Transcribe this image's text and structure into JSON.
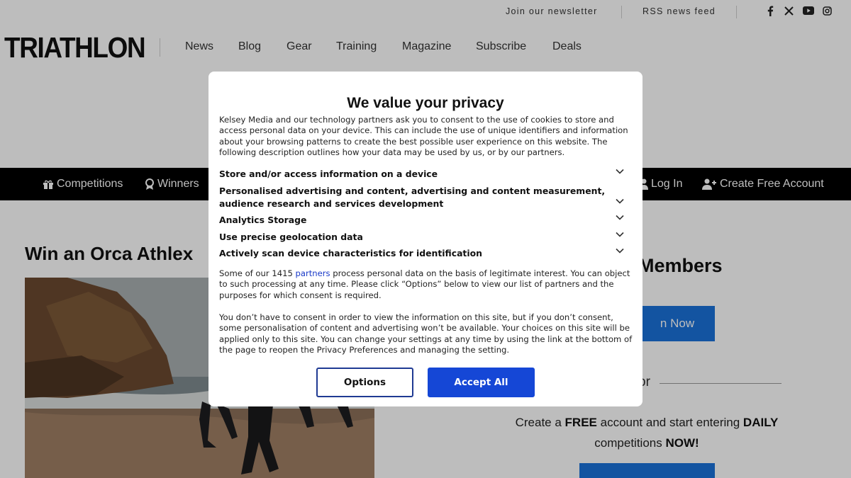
{
  "topbar": {
    "newsletter": "Join our newsletter",
    "rss": "RSS news feed",
    "social_icons": [
      "facebook-icon",
      "x-icon",
      "youtube-icon",
      "instagram-icon"
    ]
  },
  "header": {
    "logo_text": "TRIATHLON",
    "nav": [
      "News",
      "Blog",
      "Gear",
      "Training",
      "Magazine",
      "Subscribe",
      "Deals"
    ]
  },
  "subnav": {
    "competitions": "Competitions",
    "winners": "Winners",
    "login": "Log In",
    "create_account": "Create Free Account"
  },
  "article": {
    "title": "Win an Orca Athlex"
  },
  "sidebar": {
    "heading": "Members",
    "join_button": "n Now",
    "or_text": "or",
    "promo_pre": "Create a ",
    "promo_free": "FREE",
    "promo_mid": " account and start entering ",
    "promo_daily": "DAILY",
    "promo_line2": "competitions ",
    "promo_now": "NOW!"
  },
  "consent": {
    "title": "We value your privacy",
    "intro": "Kelsey Media and our technology partners ask you to consent to the use of cookies to store and access personal data on your device. This can include the use of unique identifiers and information about your browsing patterns to create the best possible user experience on this website. The following description outlines how your data may be used by us, or by our partners.",
    "purposes": [
      {
        "label": "Store and/or access information on a device"
      },
      {
        "label": "Personalised advertising and content, advertising and content measurement, audience research and services development"
      },
      {
        "label": "Analytics Storage"
      },
      {
        "label": "Use precise geolocation data"
      },
      {
        "label": "Actively scan device characteristics for identification"
      }
    ],
    "legit_pre": "Some of our 1415 ",
    "legit_link": "partners",
    "legit_post": " process personal data on the basis of legitimate interest. You can object to such processing at any time. Please click “Options” below to view our list of partners and the purposes for which consent is required.",
    "no_consent": "You don’t have to consent in order to view the information on this site, but if you don’t consent, some personalisation of content and advertising won’t be available. Your choices on this site will be applied only to this site. You can change your settings at any time by using the link at the bottom of the page to reopen the Privacy Preferences and managing the setting.",
    "options_label": "Options",
    "accept_label": "Accept All"
  },
  "colors": {
    "accept": "#1547d6",
    "options_border": "#1f3a93",
    "link": "#1a3ac8",
    "join_button": "#1a72d9",
    "subnav_bg": "#000000"
  }
}
